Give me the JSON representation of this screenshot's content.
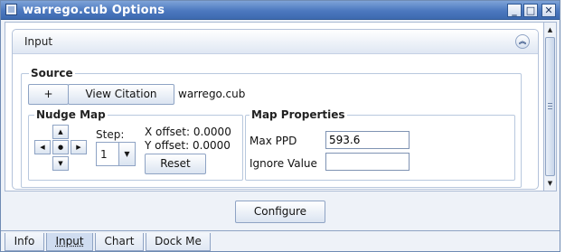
{
  "window": {
    "title": "warrego.cub Options",
    "controls": {
      "minimize": "_",
      "maximize": "□",
      "close": "✕"
    }
  },
  "input_panel": {
    "title": "Input",
    "collapse_icon": "double-chevron-up-icon"
  },
  "source": {
    "legend": "Source",
    "add_button": "+",
    "view_citation_button": "View Citation",
    "file_name": "warrego.cub"
  },
  "nudge_map": {
    "legend": "Nudge Map",
    "step_label": "Step:",
    "step_value": "1",
    "x_offset_text": "X offset: 0.0000",
    "y_offset_text": "Y offset: 0.0000",
    "reset_button": "Reset"
  },
  "map_properties": {
    "legend": "Map Properties",
    "max_ppd_label": "Max PPD",
    "max_ppd_value": "593.6",
    "ignore_value_label": "Ignore Value",
    "ignore_value_value": ""
  },
  "configure_button": "Configure",
  "tabs": [
    {
      "label": "Info",
      "selected": false
    },
    {
      "label": "Input",
      "selected": true
    },
    {
      "label": "Chart",
      "selected": false
    },
    {
      "label": "Dock Me",
      "selected": false
    }
  ],
  "colors": {
    "titlebar": "#4c78bf",
    "accent_border": "#8ea3c4",
    "background": "#eef2f8"
  }
}
